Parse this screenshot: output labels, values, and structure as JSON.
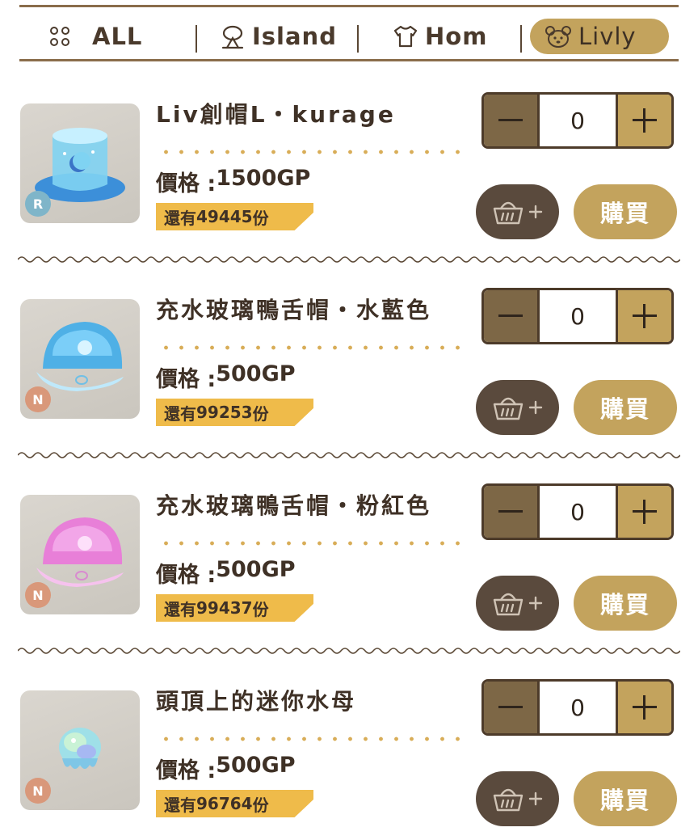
{
  "tabs": [
    {
      "label": "ALL",
      "icon": "grid-dots-icon"
    },
    {
      "label": "Island",
      "icon": "palm-tree-icon"
    },
    {
      "label": "Hom",
      "icon": "shirt-icon"
    },
    {
      "label": "Livly",
      "icon": "livly-face-icon",
      "active": true
    }
  ],
  "price_prefix": "價格 : ",
  "stock_prefix": "還有 ",
  "stock_suffix": "份",
  "buy_label": "購買",
  "colors": {
    "accent_gold": "#c3a35d",
    "stepper_dark": "#7d6746",
    "cart_dark": "#5a4a3d",
    "stock_yellow": "#efbb4a",
    "rarity_R": "#7fb5c9",
    "rarity_N": "#d9987a"
  },
  "items": [
    {
      "name": "Liv創帽L・kurage",
      "price": "1500GP",
      "stock": "49445",
      "rarity": "R",
      "qty": "0"
    },
    {
      "name": "充水玻璃鴨舌帽・水藍色",
      "price": "500GP",
      "stock": "99253",
      "rarity": "N",
      "qty": "0"
    },
    {
      "name": "充水玻璃鴨舌帽・粉紅色",
      "price": "500GP",
      "stock": "99437",
      "rarity": "N",
      "qty": "0"
    },
    {
      "name": "頭頂上的迷你水母",
      "price": "500GP",
      "stock": "96764",
      "rarity": "N",
      "qty": "0"
    }
  ]
}
